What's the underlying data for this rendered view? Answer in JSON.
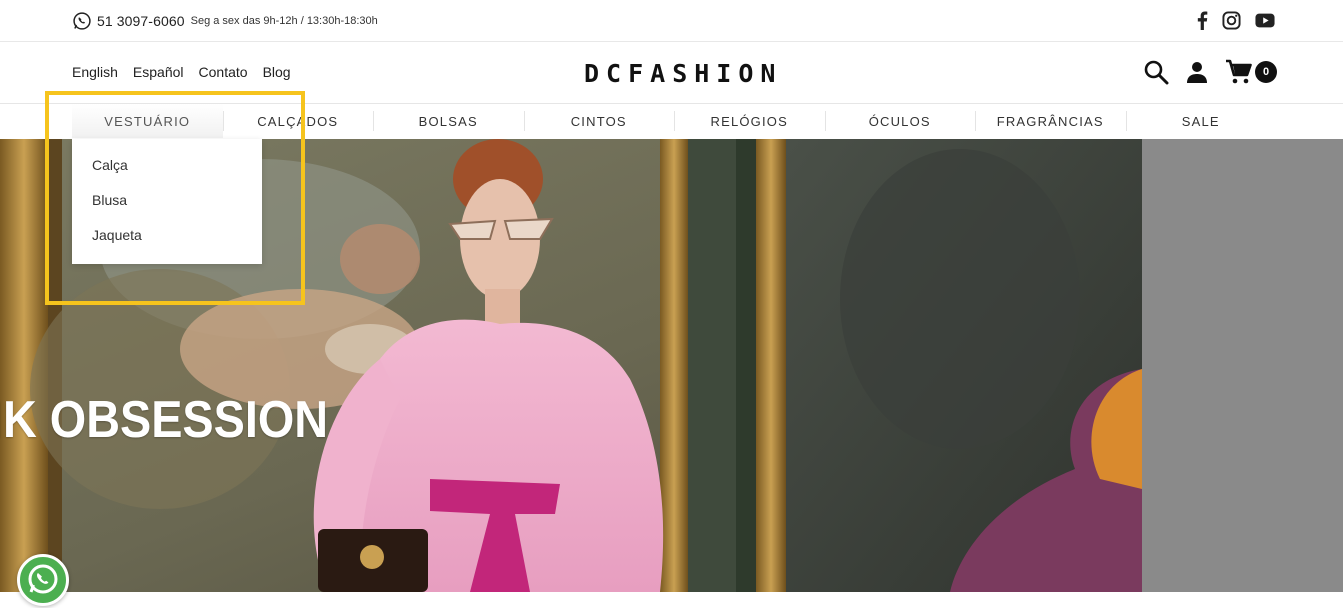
{
  "topbar": {
    "phone": "51 3097-6060",
    "hours": "Seg a sex das 9h-12h / 13:30h-18:30h",
    "social_icons": [
      "facebook-icon",
      "instagram-icon",
      "youtube-icon"
    ]
  },
  "header": {
    "languages": [
      "English",
      "Español"
    ],
    "links": [
      "Contato",
      "Blog"
    ],
    "logo": "DCFASHION",
    "cart_count": "0",
    "icons": [
      "search-icon",
      "user-icon",
      "cart-icon"
    ]
  },
  "categories": [
    "VESTUÁRIO",
    "CALÇADOS",
    "BOLSAS",
    "CINTOS",
    "RELÓGIOS",
    "ÓCULOS",
    "FRAGRÂNCIAS",
    "SALE"
  ],
  "dropdown": {
    "parent": "VESTUÁRIO",
    "items": [
      "Calça",
      "Blusa",
      "Jaqueta"
    ]
  },
  "hero": {
    "headline": "IK OBSESSION"
  },
  "colors": {
    "highlight": "#f6c41d",
    "whatsapp": "#4caf50",
    "hero_right": "#8a8a8a"
  }
}
